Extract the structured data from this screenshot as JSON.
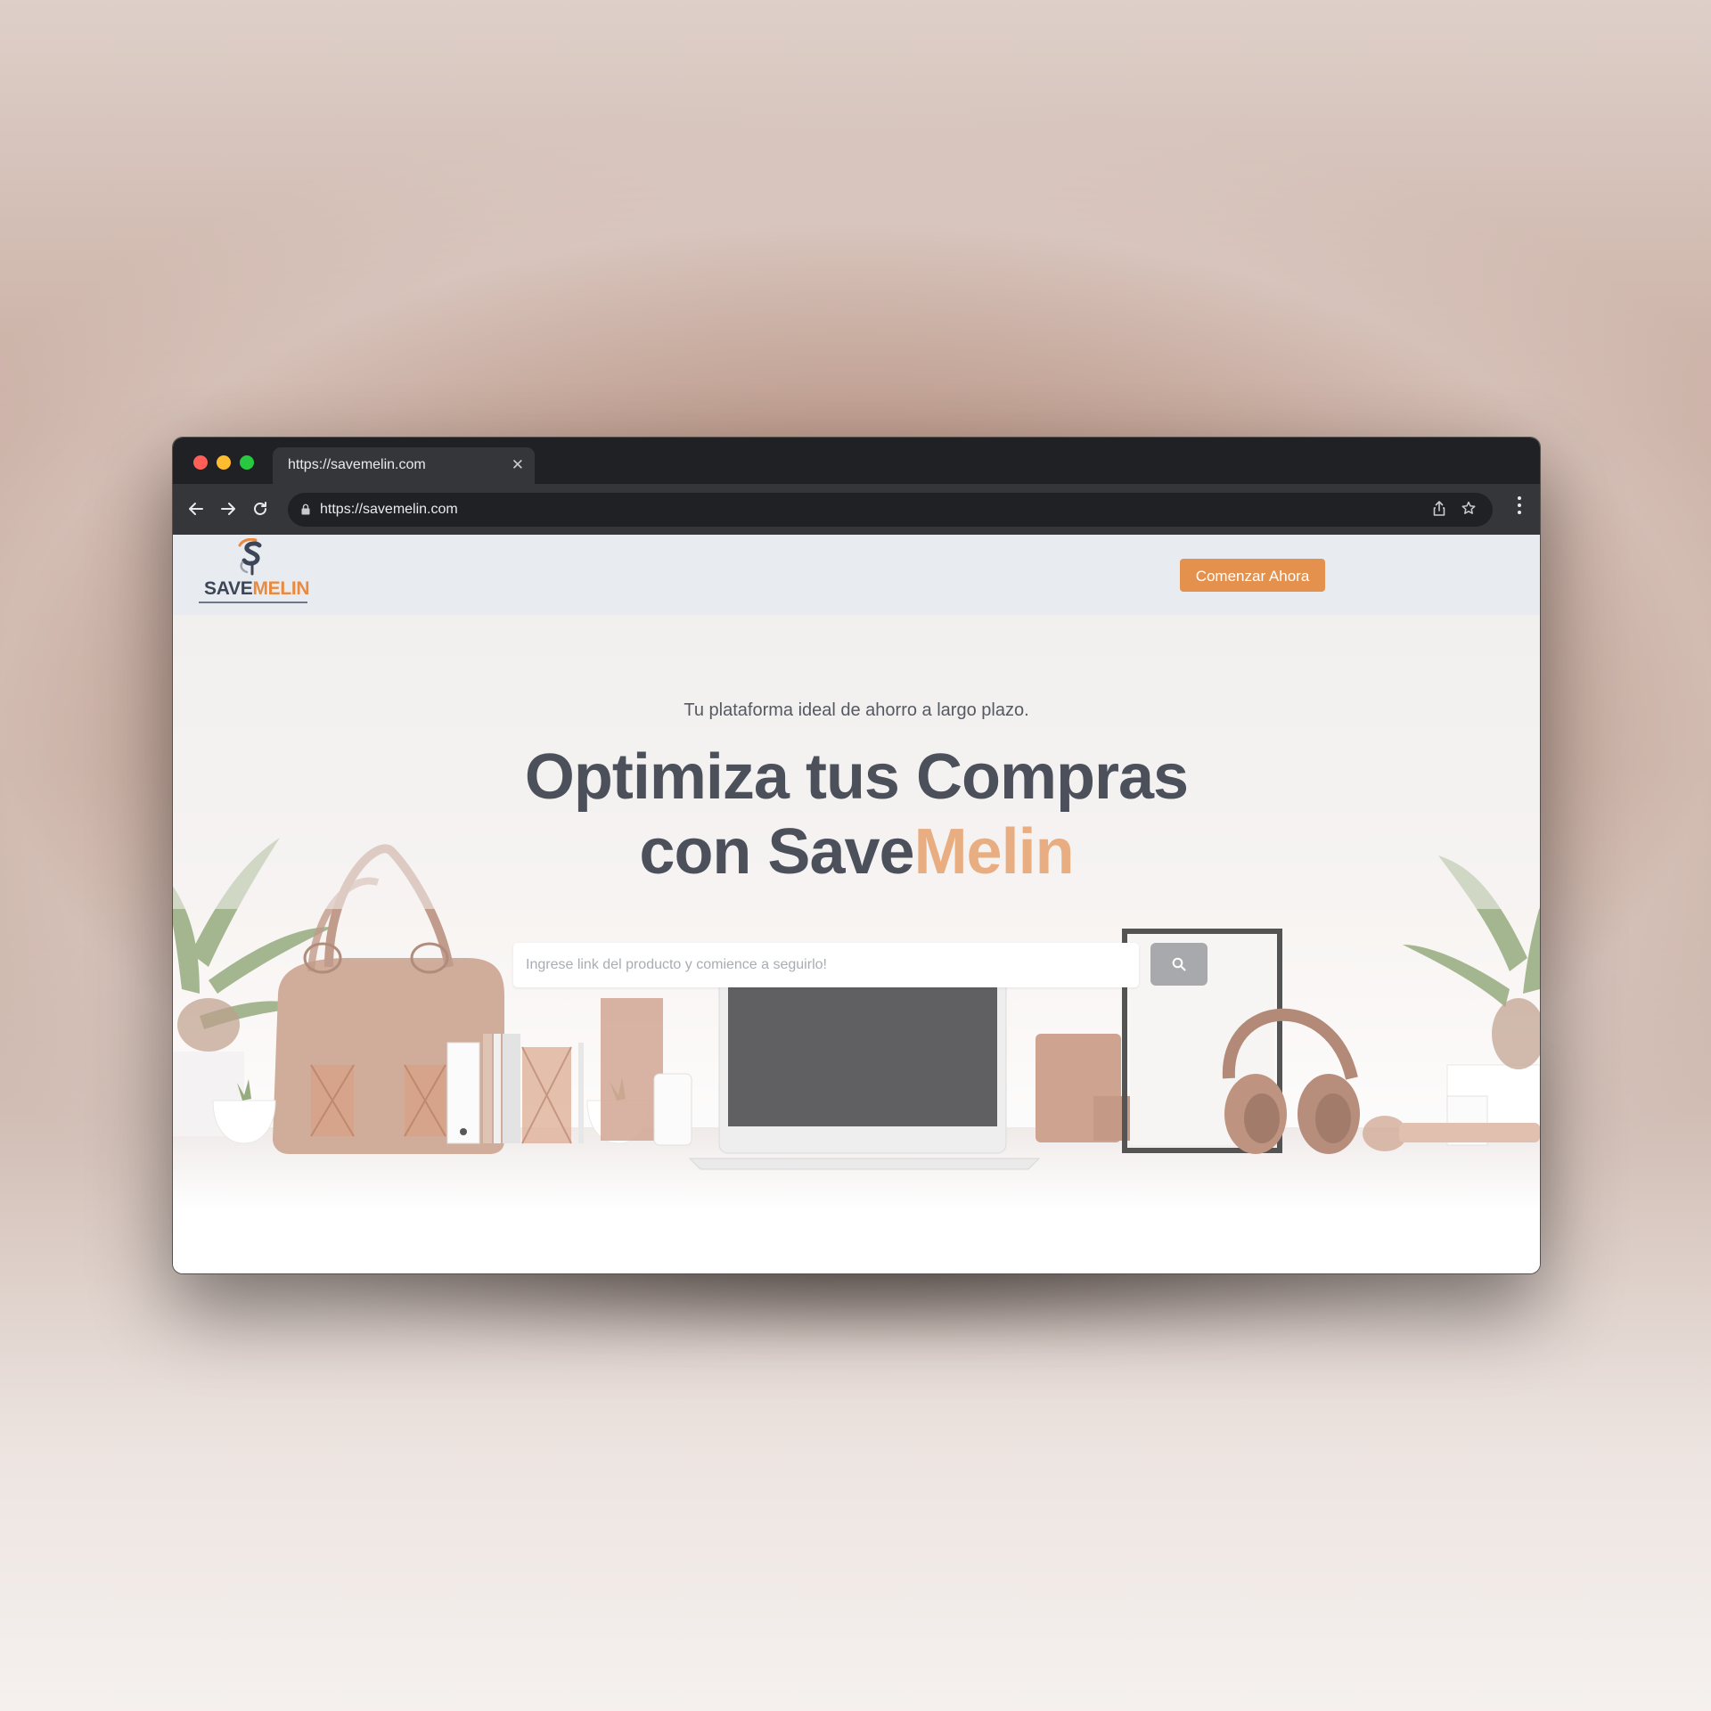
{
  "browser": {
    "tab_title": "https://savemelin.com",
    "url": "https://savemelin.com",
    "icons": [
      "close-icon",
      "back-arrow-icon",
      "forward-arrow-icon",
      "reload-icon",
      "lock-icon",
      "share-icon",
      "star-icon",
      "more-menu-icon"
    ]
  },
  "header": {
    "logo_save": "SAVE",
    "logo_melin": "MELIN",
    "cta_label": "Comenzar Ahora"
  },
  "hero": {
    "tagline": "Tu plataforma ideal de ahorro a largo plazo.",
    "headline_highlight": "Optimiza",
    "headline_rest": "tus Compras",
    "headline_line2_prefix": "con Save",
    "headline_line2_accent": "Melin",
    "search_placeholder": "Ingrese link del producto y comience a seguirlo!"
  },
  "colors": {
    "brand_orange": "#e5914e",
    "brand_dark": "#3c4656",
    "accent_text": "#e8ad80",
    "heading": "#4b505b"
  }
}
